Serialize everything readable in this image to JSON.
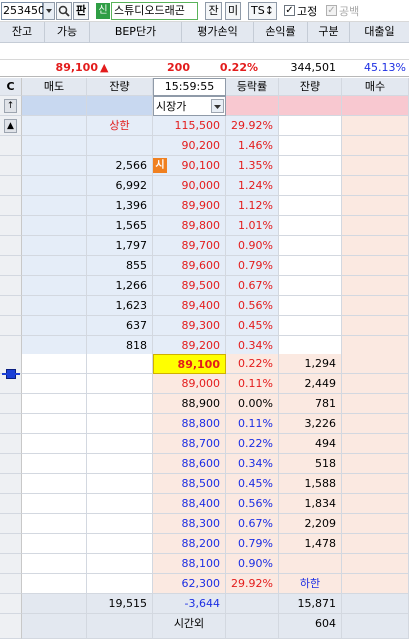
{
  "toolbar": {
    "code": "253450",
    "pan_label": "판",
    "market_badge": "신",
    "stock_name": "스튜디오드래곤",
    "jan_label": "잔",
    "mi_label": "미",
    "ts_label": "TS↕",
    "fixed_label": "고정",
    "short_label": "공백"
  },
  "summary": {
    "headers": [
      "잔고",
      "가능",
      "BEP단가",
      "평가손익",
      "손익률",
      "구분",
      "대출일"
    ],
    "price": "89,100",
    "arrow": "▲",
    "change": "200",
    "rate": "0.22%",
    "volume": "344,501",
    "ratio": "45.13%"
  },
  "orderbook": {
    "corner": "C",
    "headers": [
      "매도",
      "잔량",
      "15:59:55",
      "등락률",
      "잔량",
      "매수"
    ],
    "order_type": "시장가",
    "upper_limit_label": "상한",
    "upper_limit_price": "115,500",
    "upper_limit_rate": "29.92%",
    "lower_limit_label": "하한",
    "lower_limit_price": "62,300",
    "lower_limit_rate": "29.92%",
    "open_marker": "시",
    "asks": [
      {
        "qty": "",
        "price": "90,200",
        "rate": "1.46%"
      },
      {
        "qty": "2,566",
        "price": "90,100",
        "rate": "1.35%"
      },
      {
        "qty": "6,992",
        "price": "90,000",
        "rate": "1.24%"
      },
      {
        "qty": "1,396",
        "price": "89,900",
        "rate": "1.12%"
      },
      {
        "qty": "1,565",
        "price": "89,800",
        "rate": "1.01%"
      },
      {
        "qty": "1,797",
        "price": "89,700",
        "rate": "0.90%"
      },
      {
        "qty": "855",
        "price": "89,600",
        "rate": "0.79%"
      },
      {
        "qty": "1,266",
        "price": "89,500",
        "rate": "0.67%"
      },
      {
        "qty": "1,623",
        "price": "89,400",
        "rate": "0.56%"
      },
      {
        "qty": "637",
        "price": "89,300",
        "rate": "0.45%"
      },
      {
        "qty": "818",
        "price": "89,200",
        "rate": "0.34%"
      }
    ],
    "bids": [
      {
        "price": "89,100",
        "rate": "0.22%",
        "qty": "1,294"
      },
      {
        "price": "89,000",
        "rate": "0.11%",
        "qty": "2,449"
      },
      {
        "price": "88,900",
        "rate": "0.00%",
        "qty": "781"
      },
      {
        "price": "88,800",
        "rate": "0.11%",
        "qty": "3,226"
      },
      {
        "price": "88,700",
        "rate": "0.22%",
        "qty": "494"
      },
      {
        "price": "88,600",
        "rate": "0.34%",
        "qty": "518"
      },
      {
        "price": "88,500",
        "rate": "0.45%",
        "qty": "1,588"
      },
      {
        "price": "88,400",
        "rate": "0.56%",
        "qty": "1,834"
      },
      {
        "price": "88,300",
        "rate": "0.67%",
        "qty": "2,209"
      },
      {
        "price": "88,200",
        "rate": "0.79%",
        "qty": "1,478"
      },
      {
        "price": "88,100",
        "rate": "0.90%",
        "qty": ""
      }
    ],
    "total_ask_qty": "19,515",
    "qty_diff": "-3,644",
    "total_bid_qty": "15,871",
    "after_hours_label": "시간외",
    "after_hours_qty": "604"
  },
  "colors": {
    "rise": "#e31c1c",
    "fall": "#1c2ee3",
    "ask_bg": "#e5edf8",
    "bid_bg": "#fbe9e1",
    "current_highlight": "#ffff00",
    "header_bg": "#e3e8f0"
  },
  "icons": {
    "search": "magnifier-icon",
    "dropdown": "chevron-down-icon",
    "up": "arrow-up-icon",
    "scroll_up": "triangle-up-icon",
    "marker": "price-marker-icon"
  }
}
